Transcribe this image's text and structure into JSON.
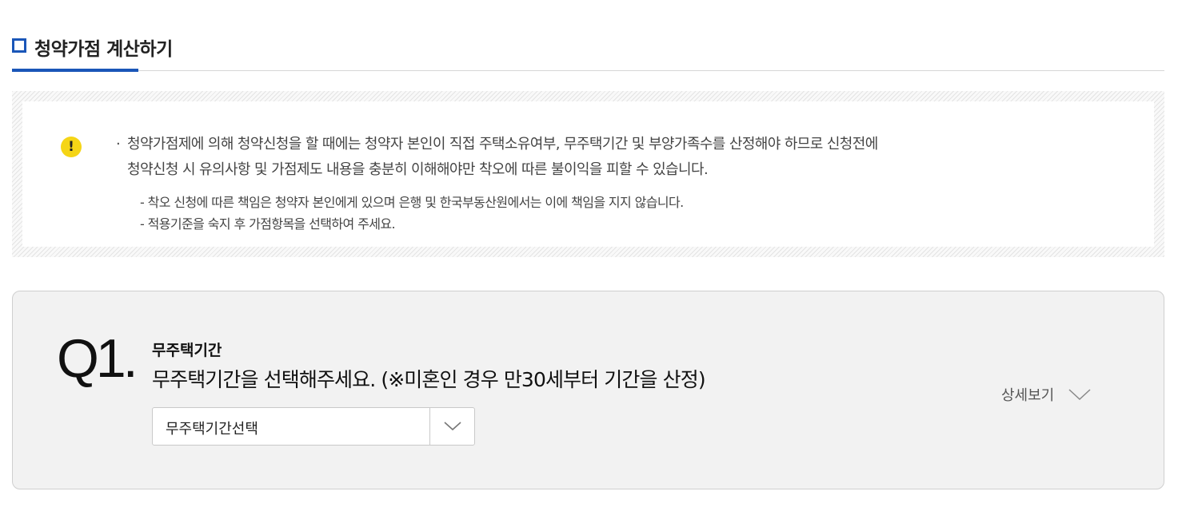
{
  "header": {
    "title": "청약가점 계산하기"
  },
  "notice": {
    "icon": "exclamation-icon",
    "bullet": "·",
    "main_lines": [
      "청약가점제에 의해 청약신청을 할 때에는 청약자 본인이 직접 주택소유여부, 무주택기간 및 부양가족수를 산정해야 하므로 신청전에",
      "청약신청 시 유의사항 및 가점제도 내용을 충분히 이해해야만 착오에 따른 불이익을 피할 수 있습니다."
    ],
    "sub_lines": [
      "- 착오 신청에 따른 책임은 청약자 본인에게 있으며 은행 및 한국부동산원에서는 이에 책임을 지지 않습니다.",
      "- 적용기준을 숙지 후 가점항목을 선택하여 주세요."
    ]
  },
  "question": {
    "number": "Q1.",
    "heading": "무주택기간",
    "description": "무주택기간을 선택해주세요. (※미혼인 경우 만30세부터 기간을 산정)",
    "select_value": "무주택기간선택",
    "detail_label": "상세보기"
  },
  "colors": {
    "accent": "#1a56b8",
    "warning": "#f5d516"
  }
}
